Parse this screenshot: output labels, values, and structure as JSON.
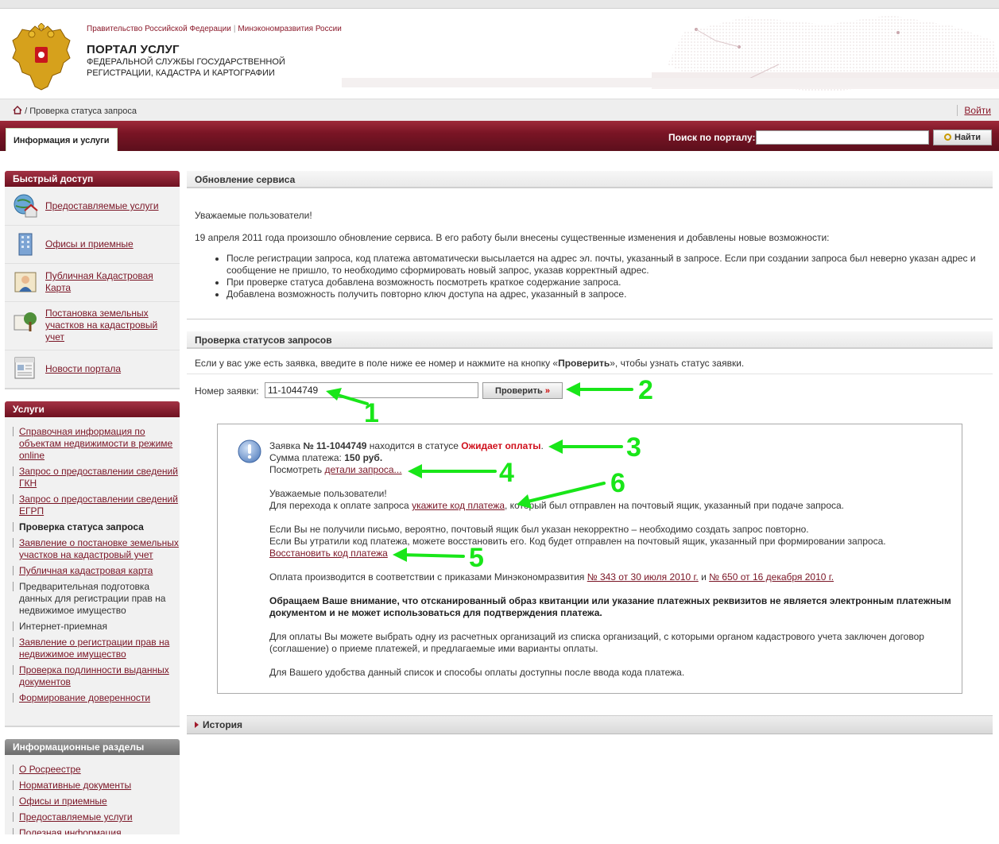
{
  "header": {
    "gov_link_1": "Правительство Российской Федерации",
    "gov_separator": "|",
    "gov_link_2": "Минэкономразвития России",
    "portal_title": "ПОРТАЛ УСЛУГ",
    "portal_sub_1": "ФЕДЕРАЛЬНОЙ СЛУЖБЫ ГОСУДАРСТВЕННОЙ",
    "portal_sub_2": "РЕГИСТРАЦИИ, КАДАСТРА И КАРТОГРАФИИ",
    "emblem_icon": "coat-of-arms-icon"
  },
  "breadcrumb": {
    "home_icon": "home-icon",
    "separator": "/",
    "current": "Проверка статуса запроса",
    "login": "Войти"
  },
  "nav": {
    "tab": "Информация и услуги",
    "search_label": "Поиск по порталу:",
    "search_value": "",
    "search_button": "Найти"
  },
  "sidebar": {
    "quick_access_title": "Быстрый доступ",
    "quick_access": [
      {
        "label": "Предоставляемые услуги",
        "icon": "globe-house-icon"
      },
      {
        "label": "Офисы и приемные",
        "icon": "building-icon"
      },
      {
        "label": "Публичная Кадастровая Карта",
        "icon": "map-person-icon"
      },
      {
        "label": "Постановка земельных участков на кадастровый учет",
        "icon": "land-tree-icon"
      },
      {
        "label": "Новости портала",
        "icon": "news-icon"
      }
    ],
    "services_title": "Услуги",
    "services": [
      {
        "label": "Справочная информация по объектам недвижимости в режиме online",
        "style": "link"
      },
      {
        "label": "Запрос о предоставлении сведений ГКН",
        "style": "link"
      },
      {
        "label": "Запрос о предоставлении сведений ЕГРП",
        "style": "link"
      },
      {
        "label": "Проверка статуса запроса",
        "style": "active"
      },
      {
        "label": "Заявление о постановке земельных участков на кадастровый учет",
        "style": "link"
      },
      {
        "label": "Публичная кадастровая карта",
        "style": "link"
      },
      {
        "label": "Предварительная подготовка данных для регистрации прав на недвижимое имущество",
        "style": "plain"
      },
      {
        "label": "Интернет-приемная",
        "style": "plain"
      },
      {
        "label": "Заявление о регистрации прав на недвижимое имущество",
        "style": "link"
      },
      {
        "label": "Проверка подлинности выданных документов",
        "style": "link"
      },
      {
        "label": "Формирование доверенности",
        "style": "link"
      }
    ],
    "info_title": "Информационные разделы",
    "info": [
      {
        "label": "О Росреестре"
      },
      {
        "label": "Нормативные документы"
      },
      {
        "label": "Офисы и приемные"
      },
      {
        "label": "Предоставляемые услуги"
      },
      {
        "label": "Полезная информация"
      }
    ]
  },
  "update_section": {
    "title": "Обновление сервиса",
    "greeting": "Уважаемые пользователи!",
    "intro": "19 апреля 2011 года  произошло обновление сервиса. В его работу были внесены существенные изменения и добавлены новые возможности:",
    "bullets": [
      "После регистрации запроса, код платежа автоматически высылается на адрес эл. почты, указанный в запросе. Если при создании запроса был неверно указан адрес и сообщение не пришло, то необходимо сформировать новый запрос, указав корректный адрес.",
      "При проверке статуса добавлена возможность посмотреть краткое содержание запроса.",
      "Добавлена возможность получить повторно ключ доступа на адрес, указанный в запросе."
    ]
  },
  "check_section": {
    "title": "Проверка статусов запросов",
    "hint_before": "Если у вас уже есть заявка, введите в поле ниже ее номер и нажмите на кнопку «",
    "hint_bold": "Проверить",
    "hint_after": "», чтобы узнать статус заявки.",
    "field_label": "Номер заявки:",
    "field_value": "11-1044749",
    "button_label": "Проверить",
    "button_suffix": "»"
  },
  "result": {
    "info_icon": "exclamation-info-icon",
    "line1_a": "Заявка ",
    "line1_num": "№ 11-1044749",
    "line1_b": " находится в статусе ",
    "line1_status": "Ожидает оплаты",
    "line1_end": ".",
    "amount_label": "Сумма платежа: ",
    "amount_value": "150 руб.",
    "details_prefix": "Посмотреть ",
    "details_link": "детали запроса...",
    "greeting": "Уважаемые пользователи!",
    "pay_before": "Для перехода к оплате запроса ",
    "pay_link": "укажите код платежа",
    "pay_after": ", который был отправлен на почтовый ящик, указанный при подаче запроса.",
    "no_letter": "Если Вы не получили письмо, вероятно, почтовый ящик был указан некорректно – необходимо создать запрос повторно.",
    "lost_code": "Если Вы утратили код платежа, можете восстановить его. Код будет отправлен на почтовый ящик, указанный при формировании запроса.",
    "restore_link": "Восстановить код платежа",
    "orders_text": "Оплата производится в соответствии с приказами Минэкономразвития ",
    "order1": "№ 343 от 30 июля 2010 г.",
    "orders_and": " и ",
    "order2": "№ 650 от 16 декабря 2010 г.",
    "warning": "Обращаем Ваше внимание, что отсканированный образ квитанции или указание платежных реквизитов не является электронным платежным документом и не может использоваться для подтверждения платежа.",
    "choose_org": "Для оплаты Вы можете выбрать одну из расчетных организаций из списка организаций, с которыми органом кадастрового учета заключен договор (соглашение) о приеме платежей, и предлагаемые ими варианты оплаты.",
    "available": "Для Вашего удобства данный список и способы оплаты доступны после ввода кода платежа."
  },
  "history": {
    "label": "История",
    "icon": "triangle-right-icon"
  },
  "annotations": {
    "color": "#19e619",
    "numbers": [
      "1",
      "2",
      "3",
      "4",
      "5",
      "6"
    ]
  },
  "colors": {
    "brand": "#7a1525",
    "status_red": "#d0101c",
    "link": "#7a1525"
  }
}
